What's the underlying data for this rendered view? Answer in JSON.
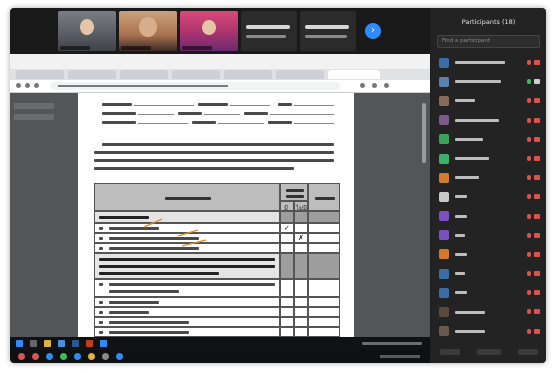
{
  "participants": {
    "title": "Participants (18)",
    "search_placeholder": "Find a participant",
    "rows": [
      {
        "avatar_color": "#3a6ea5",
        "mic": "muted",
        "cam": "off"
      },
      {
        "avatar_color": "#5a7fb0",
        "mic": "on",
        "cam": "on"
      },
      {
        "avatar_color": "#8a6a5a",
        "mic": "muted",
        "cam": "off"
      },
      {
        "avatar_color": "#7a5a8a",
        "mic": "muted",
        "cam": "off"
      },
      {
        "avatar_color": "#37a65a",
        "mic": "muted",
        "cam": "off"
      },
      {
        "avatar_color": "#3bb06a",
        "mic": "muted",
        "cam": "off"
      },
      {
        "avatar_color": "#d47b2a",
        "mic": "muted",
        "cam": "off"
      },
      {
        "avatar_color": "#c8c8c8",
        "mic": "muted",
        "cam": "off"
      },
      {
        "avatar_color": "#7a4fbf",
        "mic": "muted",
        "cam": "off"
      },
      {
        "avatar_color": "#7a4fbf",
        "mic": "muted",
        "cam": "off"
      },
      {
        "avatar_color": "#d4782a",
        "mic": "muted",
        "cam": "off"
      },
      {
        "avatar_color": "#3a6ea5",
        "mic": "muted",
        "cam": "off"
      },
      {
        "avatar_color": "#3a6ea5",
        "mic": "muted",
        "cam": "off"
      },
      {
        "avatar_color": "#5a4a3a",
        "mic": "muted",
        "cam": "off"
      },
      {
        "avatar_color": "#6a5a4a",
        "mic": "muted",
        "cam": "off"
      }
    ]
  },
  "document": {
    "marks_header_have": "มี",
    "marks_header_no": "ไม่มี",
    "check_mark": "✓",
    "cross_mark": "✗"
  },
  "colors": {
    "zoom_blue": "#2d8cff",
    "panel_bg": "#232323",
    "muted_red": "#d9534f",
    "table_header_grey": "#bdbdbd"
  }
}
